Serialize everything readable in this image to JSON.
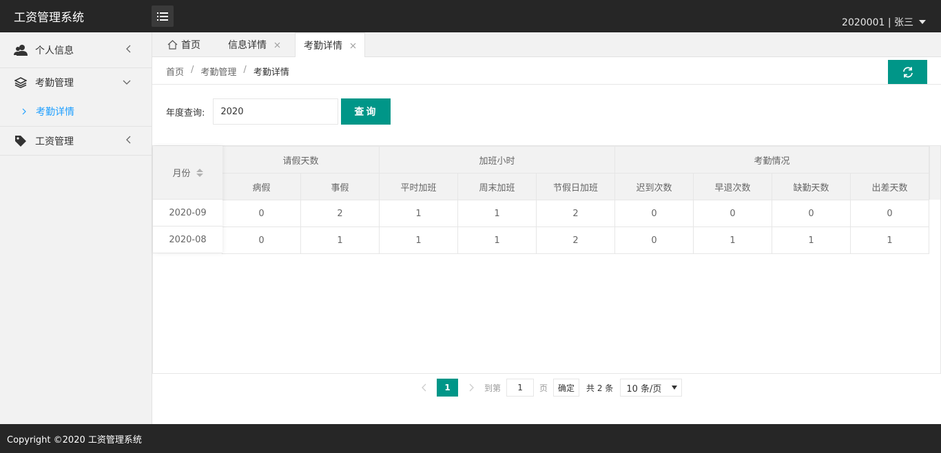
{
  "header": {
    "title": "工资管理系统",
    "user": "2020001 | 张三"
  },
  "sidebar": {
    "items": [
      {
        "label": "个人信息",
        "icon": "user-icon"
      },
      {
        "label": "考勤管理",
        "icon": "layers-icon",
        "sub": [
          {
            "label": "考勤详情"
          }
        ]
      },
      {
        "label": "工资管理",
        "icon": "tag-icon"
      }
    ]
  },
  "tabs": [
    {
      "label": "首页",
      "icon": "home-icon"
    },
    {
      "label": "信息详情"
    },
    {
      "label": "考勤详情",
      "active": true
    }
  ],
  "breadcrumb": [
    "首页",
    "考勤管理",
    "考勤详情"
  ],
  "breadcrumb_sep": "/",
  "search": {
    "label": "年度查询:",
    "value": "2020",
    "button": "查询"
  },
  "table": {
    "fixed_header": "月份",
    "groups": [
      "请假天数",
      "加班小时",
      "考勤情况"
    ],
    "columns": [
      "病假",
      "事假",
      "平时加班",
      "周末加班",
      "节假日加班",
      "迟到次数",
      "早退次数",
      "缺勤天数",
      "出差天数"
    ],
    "rows": [
      {
        "month": "2020-09",
        "values": [
          "0",
          "2",
          "1",
          "1",
          "2",
          "0",
          "0",
          "0",
          "0"
        ]
      },
      {
        "month": "2020-08",
        "values": [
          "0",
          "1",
          "1",
          "1",
          "2",
          "0",
          "1",
          "1",
          "1"
        ]
      }
    ]
  },
  "pager": {
    "current": "1",
    "goto_label": "到第",
    "goto_value": "1",
    "page_label": "页",
    "ok": "确定",
    "total": "共 2 条",
    "page_size": "10 条/页"
  },
  "footer": {
    "text": "Copyright ©2020 工资管理系统"
  },
  "colors": {
    "accent": "#009688",
    "link": "#1e9fff",
    "header_bg": "#262626"
  }
}
